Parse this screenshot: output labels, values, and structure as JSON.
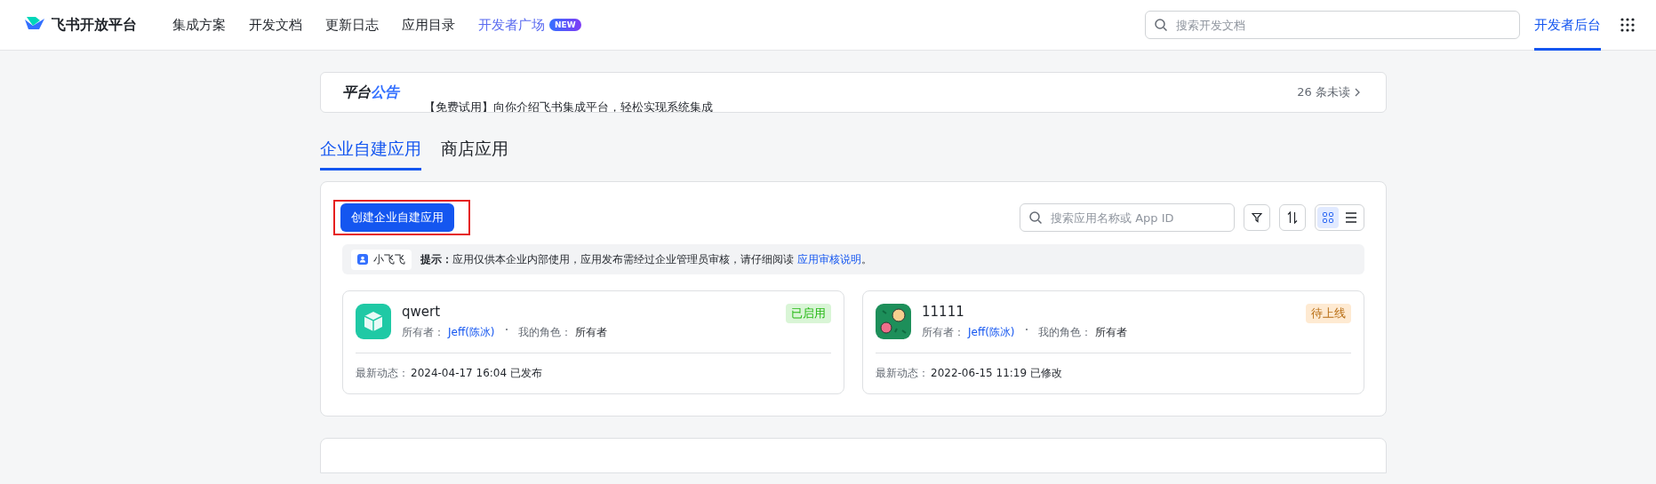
{
  "brand": "飞书开放平台",
  "nav": [
    {
      "label": "集成方案",
      "selected": false
    },
    {
      "label": "开发文档",
      "selected": false
    },
    {
      "label": "更新日志",
      "selected": false
    },
    {
      "label": "应用目录",
      "selected": false
    },
    {
      "label": "开发者广场",
      "selected": false,
      "badge": "NEW"
    }
  ],
  "search": {
    "placeholder": "搜索开发文档"
  },
  "console_link": {
    "label": "开发者后台",
    "selected": true
  },
  "announcement": {
    "title_plain": "平台",
    "title_accent": "公告",
    "message": "【免费试用】向你介绍飞书集成平台，轻松实现系统集成",
    "unread": "26 条未读"
  },
  "tabs": [
    {
      "label": "企业自建应用",
      "selected": true
    },
    {
      "label": "商店应用",
      "selected": false
    }
  ],
  "toolbar": {
    "create_button": "创建企业自建应用",
    "search_placeholder": "搜索应用名称或 App ID",
    "views": [
      {
        "kind": "grid",
        "selected": true
      },
      {
        "kind": "list",
        "selected": false
      }
    ]
  },
  "tip": {
    "bot": "小飞飞",
    "label": "提示：",
    "text": "应用仅供本企业内部使用，应用发布需经过企业管理员审核，请仔细阅读",
    "link": "应用审核说明",
    "end": "。"
  },
  "apps": [
    {
      "name": "qwert",
      "kind": "cube",
      "status": "已启用",
      "color": "#d9f5d6",
      "owner_label": "所有者：",
      "owner": "Jeff(陈冰)",
      "role_label": "我的角色：",
      "role": "所有者",
      "activity_label": "最新动态：",
      "activity": "2024-04-17 16:04 已发布"
    },
    {
      "name": "11111",
      "kind": "dots",
      "status": "待上线",
      "color": "#feead2",
      "owner_label": "所有者：",
      "owner": "Jeff(陈冰)",
      "role_label": "我的角色：",
      "role": "所有者",
      "activity_label": "最新动态：",
      "activity": "2022-06-15 11:19 已修改"
    }
  ]
}
